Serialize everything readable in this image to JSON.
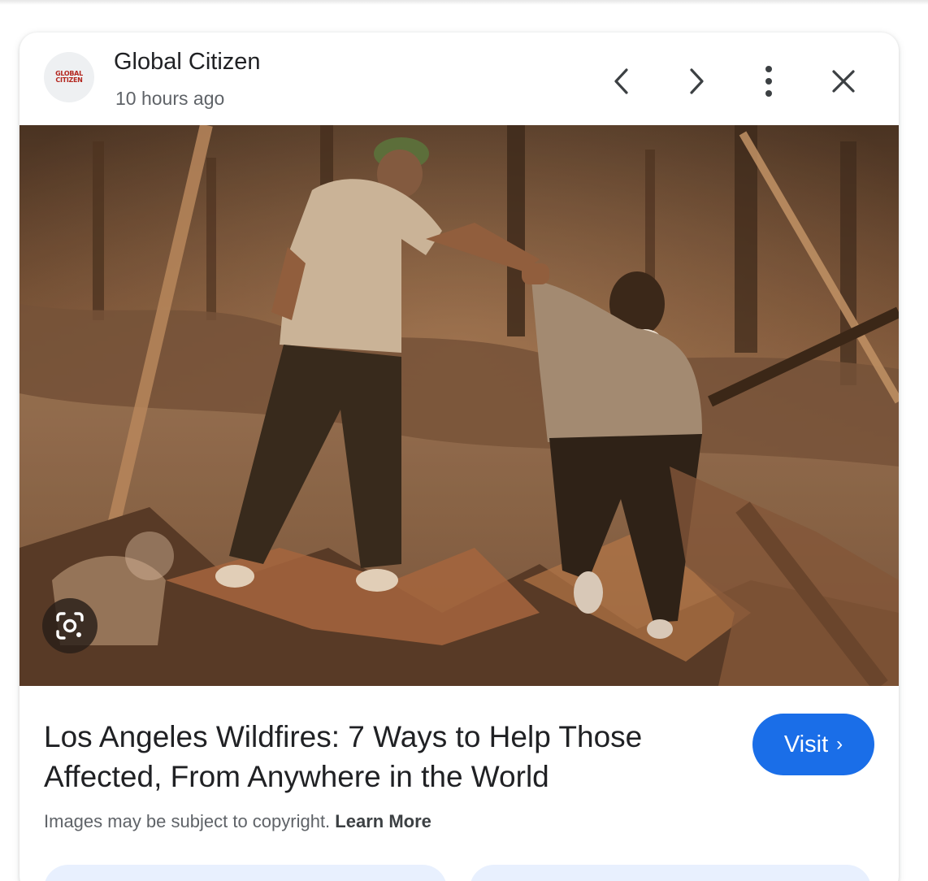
{
  "header": {
    "source_name": "Global Citizen",
    "logo_text": "GLOBAL CITIZEN",
    "timestamp": "10 hours ago"
  },
  "controls": {
    "previous_icon": "chevron-left-icon",
    "next_icon": "chevron-right-icon",
    "more_icon": "more-vertical-icon",
    "close_icon": "close-icon",
    "lens_icon": "lens-search-icon"
  },
  "article": {
    "title": "Los Angeles Wildfires: 7 Ways to Help Those Affected, From Anywhere in the World",
    "visit_label": "Visit",
    "visit_chevron": "›"
  },
  "footer": {
    "copyright_text": "Images may be subject to copyright.",
    "learn_more_label": "Learn More"
  },
  "colors": {
    "accent": "#1a6ee8",
    "pill_background": "#e8f0fe",
    "text_primary": "#202124",
    "text_secondary": "#5f6368"
  }
}
